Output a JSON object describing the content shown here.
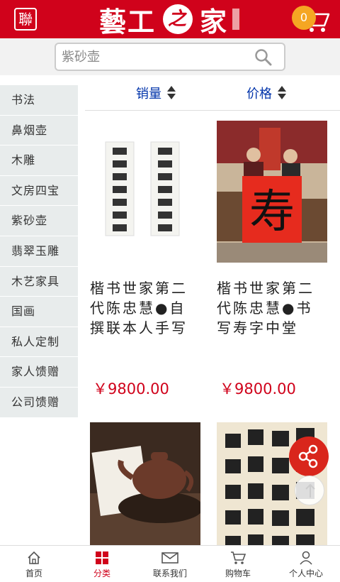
{
  "header": {
    "logo_seal": "聯",
    "brand_left": "藝工",
    "brand_mid": "之",
    "brand_right": "家",
    "cart_count": "0"
  },
  "search": {
    "placeholder": "紫砂壶"
  },
  "sidebar": {
    "items": [
      {
        "label": "书法"
      },
      {
        "label": "鼻烟壶"
      },
      {
        "label": "木雕"
      },
      {
        "label": "文房四宝"
      },
      {
        "label": "紫砂壶"
      },
      {
        "label": "翡翠玉雕"
      },
      {
        "label": "木艺家具"
      },
      {
        "label": "国画"
      },
      {
        "label": "私人定制"
      },
      {
        "label": "家人馈赠"
      },
      {
        "label": "公司馈赠"
      }
    ]
  },
  "sort": {
    "sales": "销量",
    "price": "价格"
  },
  "products": [
    {
      "title": "楷书世家第二代陈忠慧●自撰联本人手写",
      "price": "￥9800.00"
    },
    {
      "title": "楷书世家第二代陈忠慧●书写寿字中堂",
      "price": "￥9800.00"
    },
    {
      "title": "",
      "price": ""
    },
    {
      "title": "",
      "price": ""
    }
  ],
  "bottom_nav": {
    "home": "首页",
    "category": "分类",
    "contact": "联系我们",
    "cart": "购物车",
    "profile": "个人中心"
  },
  "colors": {
    "brand_red": "#d0021b",
    "badge_orange": "#f5a623",
    "sort_blue": "#0033aa"
  }
}
